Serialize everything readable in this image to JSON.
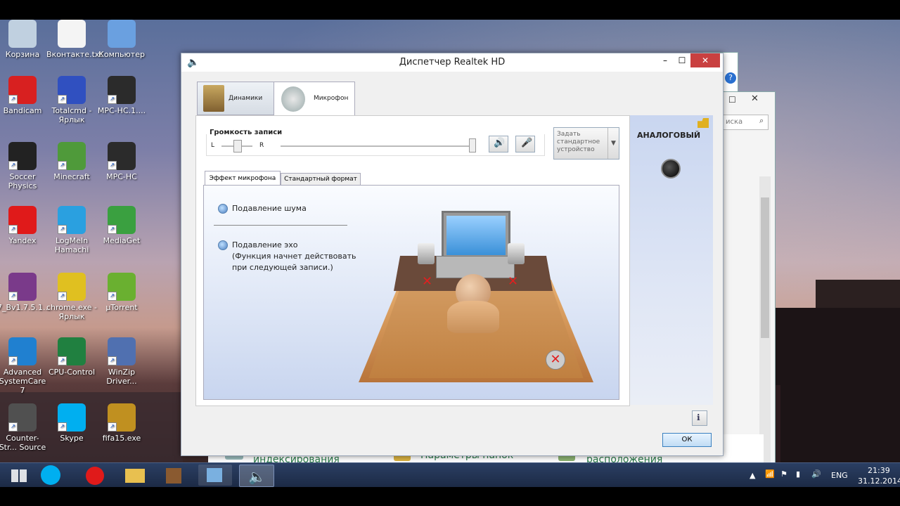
{
  "desktop": {
    "icons": [
      {
        "label": "Корзина",
        "icon": "recycle-bin-icon",
        "color": "#c0d0e0"
      },
      {
        "label": "Вконтакте.txt",
        "icon": "text-file-icon",
        "color": "#f4f4f4"
      },
      {
        "label": "Компьютер",
        "icon": "computer-icon",
        "color": "#6aa0e0"
      },
      {
        "label": "Bandicam",
        "icon": "bandicam-icon",
        "color": "#d82020"
      },
      {
        "label": "Totalcmd - Ярлык",
        "icon": "floppy-icon",
        "color": "#3050c0"
      },
      {
        "label": "MPC-HC.1....",
        "icon": "mpc-hc-icon",
        "color": "#2b2b2b"
      },
      {
        "label": "Soccer Physics",
        "icon": "unity-icon",
        "color": "#222222"
      },
      {
        "label": "Minecraft",
        "icon": "minecraft-icon",
        "color": "#4f9a3a"
      },
      {
        "label": "MPC-HC",
        "icon": "mpc-hc-icon",
        "color": "#2b2b2b"
      },
      {
        "label": "Yandex",
        "icon": "yandex-icon",
        "color": "#e01a1a"
      },
      {
        "label": "LogMeIn Hamachi",
        "icon": "hamachi-icon",
        "color": "#2aa0e0"
      },
      {
        "label": "MediaGet",
        "icon": "mediaget-icon",
        "color": "#3aa040"
      },
      {
        "label": "7_Bv1.7.5.1...",
        "icon": "winrar-icon",
        "color": "#7a3a8a"
      },
      {
        "label": "chrome.exe - Ярлык",
        "icon": "chrome-icon",
        "color": "#e0c020"
      },
      {
        "label": "µTorrent",
        "icon": "utorrent-icon",
        "color": "#6ab030"
      },
      {
        "label": "Advanced SystemCare 7",
        "icon": "systemcare-icon",
        "color": "#2080d0"
      },
      {
        "label": "CPU-Control",
        "icon": "chip-icon",
        "color": "#208040"
      },
      {
        "label": "WinZip Driver...",
        "icon": "winzip-icon",
        "color": "#5070b0"
      },
      {
        "label": "Counter-Str... Source",
        "icon": "counter-strike-icon",
        "color": "#505050"
      },
      {
        "label": "Skype",
        "icon": "skype-icon",
        "color": "#00aff0"
      },
      {
        "label": "fifa15.exe",
        "icon": "fifa-icon",
        "color": "#c09020"
      }
    ]
  },
  "bg_window": {
    "search_placeholder": "иска",
    "items": [
      {
        "label": "Параметры индексирования",
        "icon": "indexing-icon"
      },
      {
        "label": "Параметры папок",
        "icon": "folder-options-icon"
      },
      {
        "label": "Параметры расположения",
        "icon": "location-icon"
      }
    ]
  },
  "dialog": {
    "title": "Диспетчер Realtek HD",
    "tabs": [
      {
        "label": "Динамики",
        "icon": "speakers-icon"
      },
      {
        "label": "Микрофон",
        "icon": "microphone-icon"
      }
    ],
    "volume": {
      "group_label": "Громкость записи",
      "left_label": "L",
      "right_label": "R",
      "balance": 0.5,
      "level": 1.0
    },
    "default_device_label": "Задать стандартное устройство",
    "side_panel": {
      "title": "АНАЛОГОВЫЙ"
    },
    "subtabs": [
      {
        "label": "Эффект микрофона"
      },
      {
        "label": "Стандартный формат"
      }
    ],
    "options": [
      {
        "label": "Подавление шума"
      },
      {
        "label": "Подавление эхо\n(Функция начнет действовать\nпри следующей записи.)"
      }
    ],
    "ok_label": "ОК"
  },
  "taskbar": {
    "apps": [
      {
        "icon": "windows-start-icon"
      },
      {
        "icon": "skype-icon"
      },
      {
        "icon": "yandex-icon"
      },
      {
        "icon": "explorer-icon"
      },
      {
        "icon": "minecraft-icon"
      },
      {
        "icon": "control-panel-icon"
      },
      {
        "icon": "realtek-speaker-icon"
      }
    ],
    "language": "ENG",
    "time": "21:39",
    "date": "31.12.2014"
  },
  "colors": {
    "accent": "#3a6ea5",
    "taskbar": "#1c2a45"
  }
}
